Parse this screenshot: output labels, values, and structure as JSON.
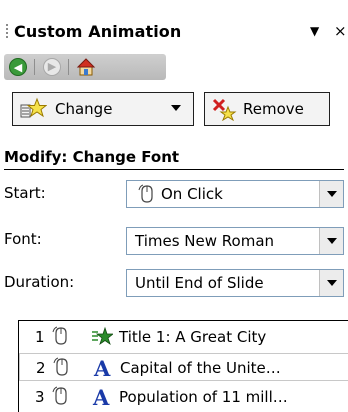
{
  "pane": {
    "title": "Custom Animation",
    "menu_glyph": "▼",
    "close_glyph": "×"
  },
  "nav": {
    "back_icon": "back-arrow-icon",
    "forward_icon": "forward-arrow-icon",
    "home_icon": "home-icon"
  },
  "toolbar": {
    "change_label": "Change",
    "remove_label": "Remove"
  },
  "modify": {
    "heading": "Modify: Change Font",
    "start_label": "Start:",
    "start_value": "On Click",
    "font_label": "Font:",
    "font_value": "Times New Roman",
    "duration_label": "Duration:",
    "duration_value": "Until End of Slide"
  },
  "animation_list": [
    {
      "number": "1",
      "icon": "star-effect-icon",
      "text": "Title 1: A Great City"
    },
    {
      "number": "2",
      "icon": "font-effect-icon",
      "text": "Capital of the Unite…"
    },
    {
      "number": "3",
      "icon": "font-effect-icon",
      "text": "Population of 11 mill…"
    }
  ],
  "colors": {
    "back_button": "#3a9a3a",
    "font_effect": "#1a3aa8",
    "star_effect": "#2a8a2a"
  }
}
